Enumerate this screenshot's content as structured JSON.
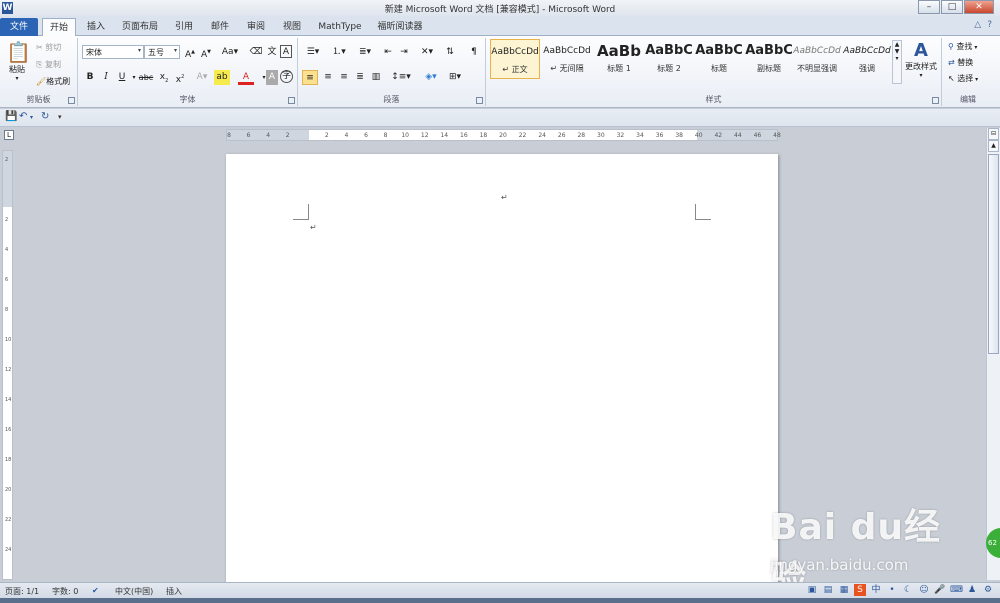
{
  "title_bar": {
    "title": "新建 Microsoft Word 文档 [兼容模式] - Microsoft Word",
    "logo": "W",
    "buttons": [
      "–",
      "□",
      "✕"
    ]
  },
  "tabs": {
    "file": "文件",
    "items": [
      "开始",
      "插入",
      "页面布局",
      "引用",
      "邮件",
      "审阅",
      "视图",
      "MathType",
      "福昕阅读器"
    ],
    "active": "开始"
  },
  "ribbon": {
    "clipboard": {
      "label": "剪贴板",
      "paste": "粘贴",
      "cut": "剪切",
      "copy": "复制",
      "format_painter": "格式刷"
    },
    "font": {
      "label": "字体",
      "font_name": "宋体",
      "font_size": "五号"
    },
    "paragraph": {
      "label": "段落"
    },
    "styles": {
      "label": "样式",
      "items": [
        {
          "sample": "AaBbCcDd",
          "name": "↵ 正文"
        },
        {
          "sample": "AaBbCcDd",
          "name": "↵ 无间隔"
        },
        {
          "sample": "AaBb",
          "name": "标题 1"
        },
        {
          "sample": "AaBbC",
          "name": "标题 2"
        },
        {
          "sample": "AaBbC",
          "name": "标题"
        },
        {
          "sample": "AaBbC",
          "name": "副标题"
        },
        {
          "sample": "AaBbCcDd",
          "name": "不明显强调"
        },
        {
          "sample": "AaBbCcDd",
          "name": "强调"
        }
      ],
      "change_styles": "更改样式"
    },
    "editing": {
      "label": "编辑",
      "find": "查找",
      "replace": "替换",
      "select": "选择"
    }
  },
  "ruler": {
    "corner": "L",
    "h_ticks": [
      "8",
      "6",
      "4",
      "2",
      "",
      "2",
      "4",
      "6",
      "8",
      "10",
      "12",
      "14",
      "16",
      "18",
      "20",
      "22",
      "24",
      "26",
      "28",
      "30",
      "32",
      "34",
      "36",
      "38",
      "40",
      "42",
      "44",
      "46",
      "48"
    ],
    "v_ticks": [
      "2",
      "",
      "2",
      "4",
      "6",
      "8",
      "10",
      "12",
      "14",
      "16",
      "18",
      "20",
      "22",
      "24"
    ]
  },
  "document": {
    "header_mark": "↵",
    "body_mark": "↵"
  },
  "status_bar": {
    "page": "页面: 1/1",
    "words": "字数: 0",
    "language": "中文(中国)",
    "mode": "插入"
  },
  "watermark": {
    "brand": "Bai du经验",
    "url": "jingyan.baidu.com"
  },
  "side_badge": "62"
}
